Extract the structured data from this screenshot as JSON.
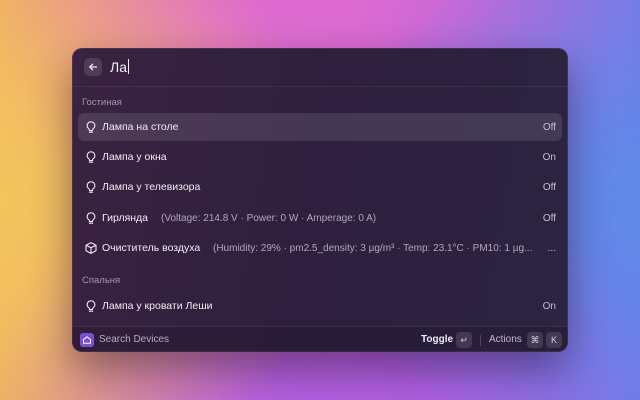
{
  "search": {
    "query": "Ла"
  },
  "sections": [
    {
      "title": "Гостиная",
      "items": [
        {
          "title": "Лампа на столе",
          "subtitle": "",
          "accessory": "Off",
          "icon": "bulb-icon",
          "selected": true
        },
        {
          "title": "Лампа у окна",
          "subtitle": "",
          "accessory": "On",
          "icon": "bulb-icon"
        },
        {
          "title": "Лампа у телевизора",
          "subtitle": "",
          "accessory": "Off",
          "icon": "bulb-icon"
        },
        {
          "title": "Гирлянда",
          "subtitle": "(Voltage: 214.8 V · Power: 0 W · Amperage: 0 A)",
          "accessory": "Off",
          "icon": "bulb-icon"
        },
        {
          "title": "Очиститель воздуха",
          "subtitle": "(Humidity: 29% · pm2.5_density: 3 µg/m³ · Temp: 23.1°C · PM10: 1 µg...",
          "accessory": "...",
          "icon": "cube-icon"
        }
      ]
    },
    {
      "title": "Спальня",
      "items": [
        {
          "title": "Лампа у кровати Леши",
          "subtitle": "",
          "accessory": "On",
          "icon": "bulb-icon"
        }
      ]
    }
  ],
  "footer": {
    "extension_name": "Search Devices",
    "primary_action": "Toggle",
    "primary_key": "↵",
    "actions_label": "Actions",
    "actions_key_1": "⌘",
    "actions_key_2": "K"
  },
  "colors": {
    "accent": "#7a4fd6",
    "selection": "#4a3a52"
  }
}
